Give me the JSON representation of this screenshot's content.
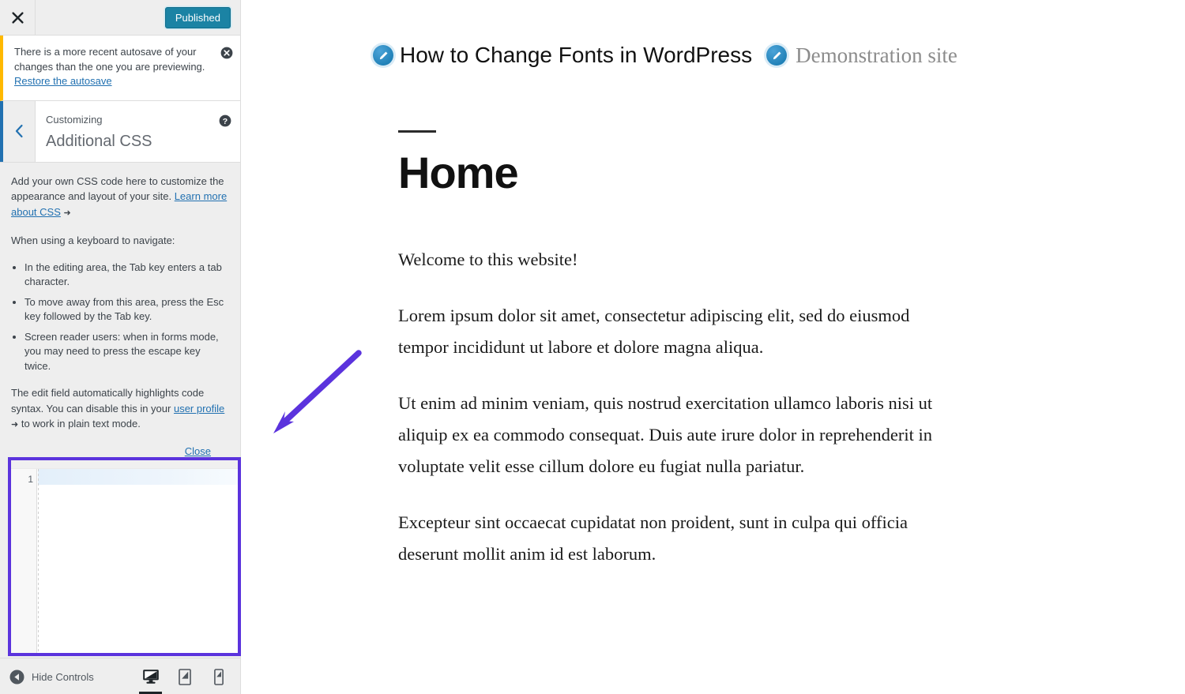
{
  "customizer": {
    "topbar": {
      "close_icon": "close-icon",
      "published_label": "Published"
    },
    "notice": {
      "text": "There is a more recent autosave of your changes than the one you are previewing. ",
      "link_label": "Restore the autosave",
      "dismiss_icon": "dismiss-circle-icon"
    },
    "section": {
      "back_icon": "chevron-left-icon",
      "eyebrow": "Customizing",
      "title": "Additional CSS",
      "help_icon": "help-circle-icon"
    },
    "description": {
      "intro": "Add your own CSS code here to customize the appearance and layout of your site. ",
      "intro_link": "Learn more about CSS",
      "keyboard_heading": "When using a keyboard to navigate:",
      "bullets": [
        "In the editing area, the Tab key enters a tab character.",
        "To move away from this area, press the Esc key followed by the Tab key.",
        "Screen reader users: when in forms mode, you may need to press the escape key twice."
      ],
      "syntax_before": "The edit field automatically highlights code syntax. You can disable this in your ",
      "syntax_link": "user profile",
      "syntax_after": " to work in plain text mode.",
      "close_label": "Close",
      "external_icon": "external-link-icon"
    },
    "editor": {
      "line_number": "1",
      "value": "",
      "highlight_color": "#5b33dd"
    },
    "footer": {
      "hide_controls_label": "Hide Controls",
      "collapse_icon": "collapse-circle-icon",
      "devices": [
        {
          "name": "desktop",
          "icon": "desktop-icon",
          "active": true
        },
        {
          "name": "tablet",
          "icon": "tablet-icon",
          "active": false
        },
        {
          "name": "mobile",
          "icon": "mobile-icon",
          "active": false
        }
      ]
    }
  },
  "preview": {
    "edit_icon": "edit-pencil-icon",
    "site_title": "How to Change Fonts in WordPress",
    "site_tagline": "Demonstration site",
    "page_title": "Home",
    "paragraphs": [
      "Welcome to this website!",
      "Lorem ipsum dolor sit amet, consectetur adipiscing elit, sed do eiusmod tempor incididunt ut labore et dolore magna aliqua.",
      "Ut enim ad minim veniam, quis nostrud exercitation ullamco laboris nisi ut aliquip ex ea commodo consequat. Duis aute irure dolor in reprehenderit in voluptate velit esse cillum dolore eu fugiat nulla pariatur.",
      "Excepteur sint occaecat cupidatat non proident, sunt in culpa qui officia deserunt mollit anim id est laborum."
    ]
  },
  "annotation": {
    "arrow_color": "#5b33dd",
    "arrow_name": "pointer-arrow"
  }
}
